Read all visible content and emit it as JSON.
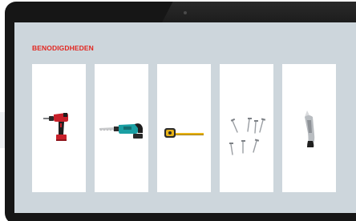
{
  "section": {
    "title": "BENODIGDHEDEN"
  },
  "colors": {
    "title": "#e3261f",
    "screen_background": "#cdd6dc",
    "card_background": "#ffffff",
    "device_bezel": "#161616"
  },
  "items": [
    {
      "icon": "cordless-drill-icon",
      "tool_color": "#c8202a"
    },
    {
      "icon": "reciprocating-saw-icon",
      "tool_color": "#1a9fa3"
    },
    {
      "icon": "tape-measure-icon",
      "tool_color": "#e8b317"
    },
    {
      "icon": "nails-screws-icon",
      "tool_color": "#9a9ea3"
    },
    {
      "icon": "utility-knife-icon",
      "tool_color": "#b9bdc1"
    }
  ]
}
